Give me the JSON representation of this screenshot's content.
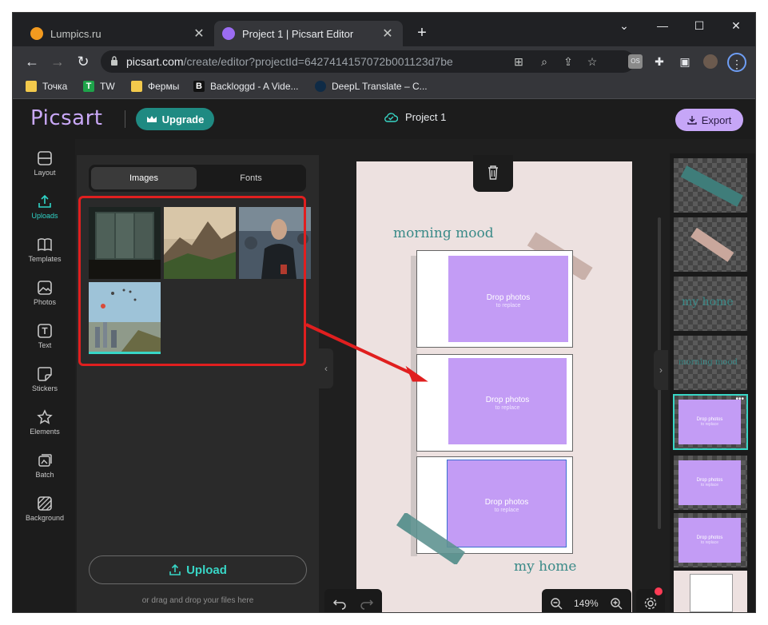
{
  "browser": {
    "tabs": [
      {
        "title": "Lumpics.ru",
        "favicon_color": "#f29a1f",
        "active": false
      },
      {
        "title": "Project 1 | Picsart Editor",
        "favicon_color": "#9b6cf2",
        "active": true
      }
    ],
    "new_tab": "+",
    "window_controls": {
      "dropdown": "⌄",
      "minimize": "—",
      "maximize": "☐",
      "close": "✕"
    },
    "url": {
      "host": "picsart.com",
      "path": "/create/editor?projectId=6427414157072b001123d7be"
    },
    "bookmarks": [
      {
        "label": "Точка",
        "icon_color": "#f2c94c"
      },
      {
        "label": "TW",
        "icon_color": "#1ea34a"
      },
      {
        "label": "Фермы",
        "icon_color": "#f2c94c"
      },
      {
        "label": "Backloggd - A Vide...",
        "icon_color": "#111111"
      },
      {
        "label": "DeepL Translate – C...",
        "icon_color": "#0f2b46"
      }
    ]
  },
  "app": {
    "logo": "Picsart",
    "upgrade_label": "Upgrade",
    "project_name": "Project 1",
    "export_label": "Export",
    "rail": [
      {
        "label": "Layout",
        "icon": "layout-icon"
      },
      {
        "label": "Uploads",
        "icon": "upload-icon",
        "active": true
      },
      {
        "label": "Templates",
        "icon": "book-icon"
      },
      {
        "label": "Photos",
        "icon": "image-icon"
      },
      {
        "label": "Text",
        "icon": "text-icon"
      },
      {
        "label": "Stickers",
        "icon": "sticker-icon"
      },
      {
        "label": "Elements",
        "icon": "star-icon"
      },
      {
        "label": "Batch",
        "icon": "batch-icon"
      },
      {
        "label": "Background",
        "icon": "background-icon"
      }
    ],
    "panel": {
      "tabs": [
        "Images",
        "Fonts"
      ],
      "active_tab": "Images",
      "upload_label": "Upload",
      "drop_hint": "or drag and drop your files here"
    },
    "canvas": {
      "text_top": "morning mood",
      "text_bottom": "my home",
      "placeholder_title": "Drop photos",
      "placeholder_sub": "to replace",
      "zoom": "149%"
    },
    "colors": {
      "accent": "#2fd4c7",
      "purple": "#c39cf5",
      "highlight": "#e01f1f"
    },
    "layers": {
      "text_layers": [
        "my home",
        "morning mood"
      ]
    }
  }
}
